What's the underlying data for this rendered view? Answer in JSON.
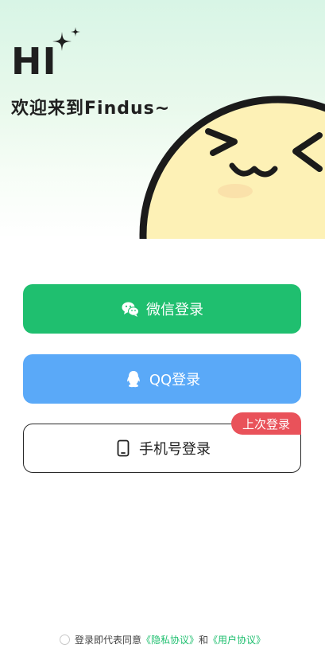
{
  "hero": {
    "greeting": "HI",
    "welcome": "欢迎来到Findus~"
  },
  "buttons": {
    "wechat_label": "微信登录",
    "qq_label": "QQ登录",
    "phone_label": "手机号登录",
    "last_login_badge": "上次登录"
  },
  "agreement": {
    "prefix": "登录即代表同意",
    "privacy_link": "《隐私协议》",
    "conjunction": "和",
    "user_link": "《用户协议》"
  },
  "colors": {
    "wechat": "#1fbf6f",
    "qq": "#5aa9f8",
    "badge": "#e9525a",
    "link": "#1fbf6f"
  },
  "icons": [
    "sparkle-icon",
    "wechat-icon",
    "qq-penguin-icon",
    "phone-icon",
    "mascot-face"
  ]
}
